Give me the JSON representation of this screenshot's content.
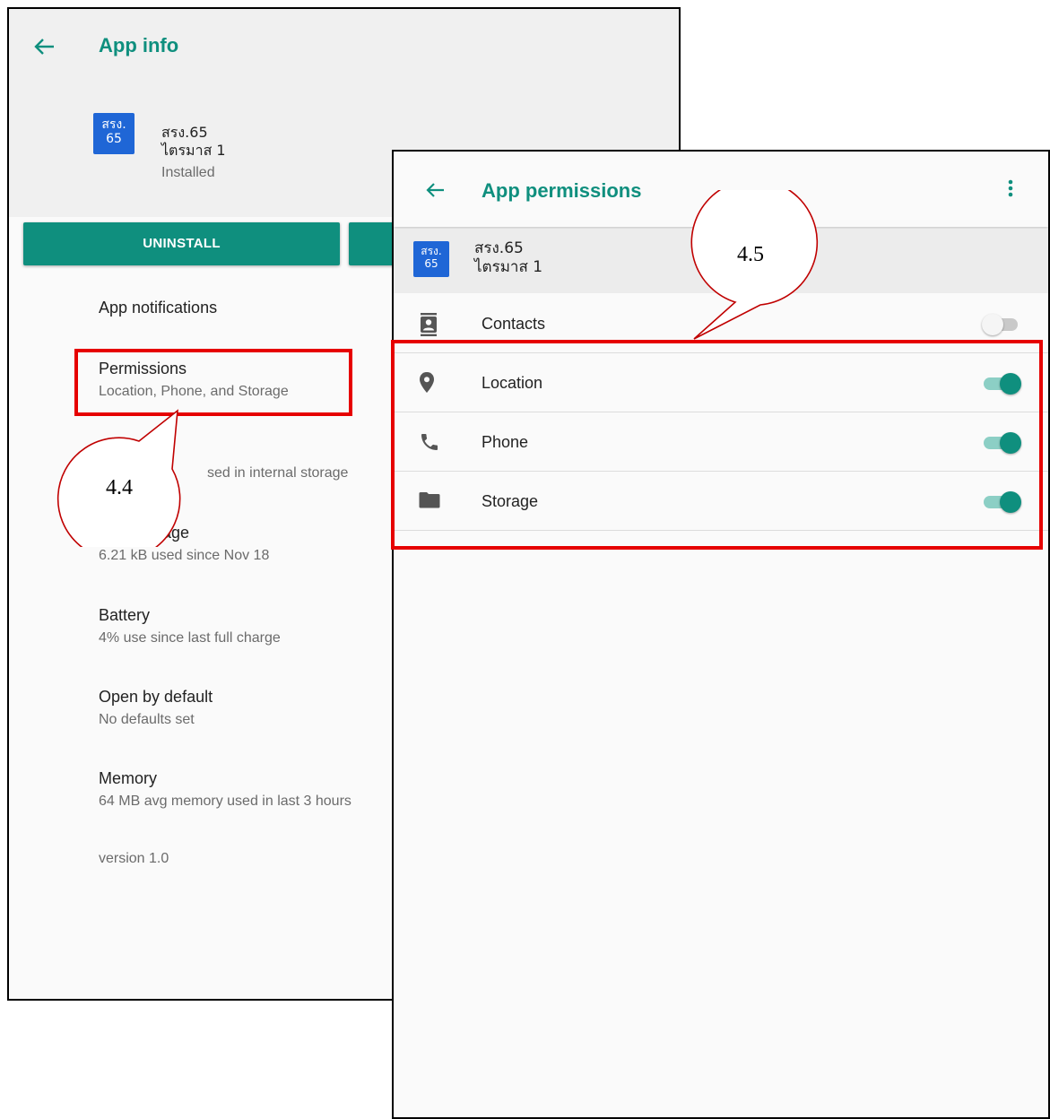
{
  "app_info": {
    "title": "App info",
    "app_icon_text": [
      "สรง.",
      "65"
    ],
    "app_name_lines": [
      "สรง.65",
      "ไตรมาส 1"
    ],
    "status": "Installed",
    "uninstall_label": "UNINSTALL",
    "prefs": {
      "notifications": {
        "title": "App notifications"
      },
      "permissions": {
        "title": "Permissions",
        "subtitle": "Location, Phone, and Storage"
      },
      "storage": {
        "subtitle_visible": "sed in internal storage"
      },
      "data_usage": {
        "title_visible": "age",
        "subtitle": "6.21 kB used since Nov 18"
      },
      "battery": {
        "title": "Battery",
        "subtitle": "4% use since last full charge"
      },
      "open_by_default": {
        "title": "Open by default",
        "subtitle": "No defaults set"
      },
      "memory": {
        "title": "Memory",
        "subtitle": "64 MB avg memory used in last 3 hours"
      },
      "version": "version 1.0"
    }
  },
  "app_permissions": {
    "title": "App permissions",
    "app_icon_text": [
      "สรง.",
      "65"
    ],
    "app_name_lines": [
      "สรง.65",
      "ไตรมาส 1"
    ],
    "permissions": [
      {
        "label": "Contacts",
        "icon": "contacts-icon",
        "enabled": false
      },
      {
        "label": "Location",
        "icon": "location-pin-icon",
        "enabled": true
      },
      {
        "label": "Phone",
        "icon": "phone-icon",
        "enabled": true
      },
      {
        "label": "Storage",
        "icon": "folder-icon",
        "enabled": true
      }
    ]
  },
  "annotations": {
    "callout_1": "4.4",
    "callout_2": "4.5"
  },
  "colors": {
    "accent": "#0f8f7e",
    "highlight": "#e60000",
    "app_icon_bg": "#1f66d6"
  }
}
